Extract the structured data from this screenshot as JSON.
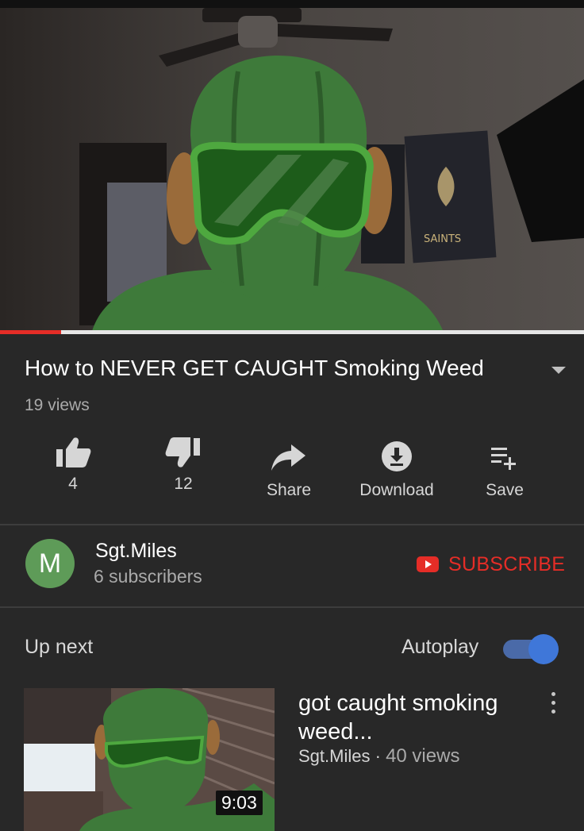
{
  "video": {
    "progress_fraction": 0.105,
    "poster_text": "SAINTS"
  },
  "title": "How to NEVER GET CAUGHT Smoking Weed",
  "views": "19 views",
  "actions": {
    "like_count": "4",
    "dislike_count": "12",
    "share_label": "Share",
    "download_label": "Download",
    "save_label": "Save"
  },
  "channel": {
    "avatar_letter": "M",
    "name": "Sgt.Miles",
    "subscribers": "6 subscribers",
    "subscribe_label": "SUBSCRIBE"
  },
  "upnext": {
    "label": "Up next",
    "autoplay_label": "Autoplay",
    "autoplay_on": true
  },
  "recommended": [
    {
      "title": "got caught smoking weed...",
      "channel": "Sgt.Miles",
      "separator": "·",
      "views": "40 views",
      "duration": "9:03"
    }
  ],
  "colors": {
    "background": "#282828",
    "accent_red": "#e52d27",
    "toggle_blue": "#3f77d9",
    "avatar_green": "#5e9b58",
    "mask_green": "#3e7a3a"
  },
  "icons": [
    "like-icon",
    "dislike-icon",
    "share-icon",
    "download-icon",
    "save-playlist-icon",
    "caret-down-icon",
    "more-vert-icon",
    "youtube-play-icon"
  ]
}
